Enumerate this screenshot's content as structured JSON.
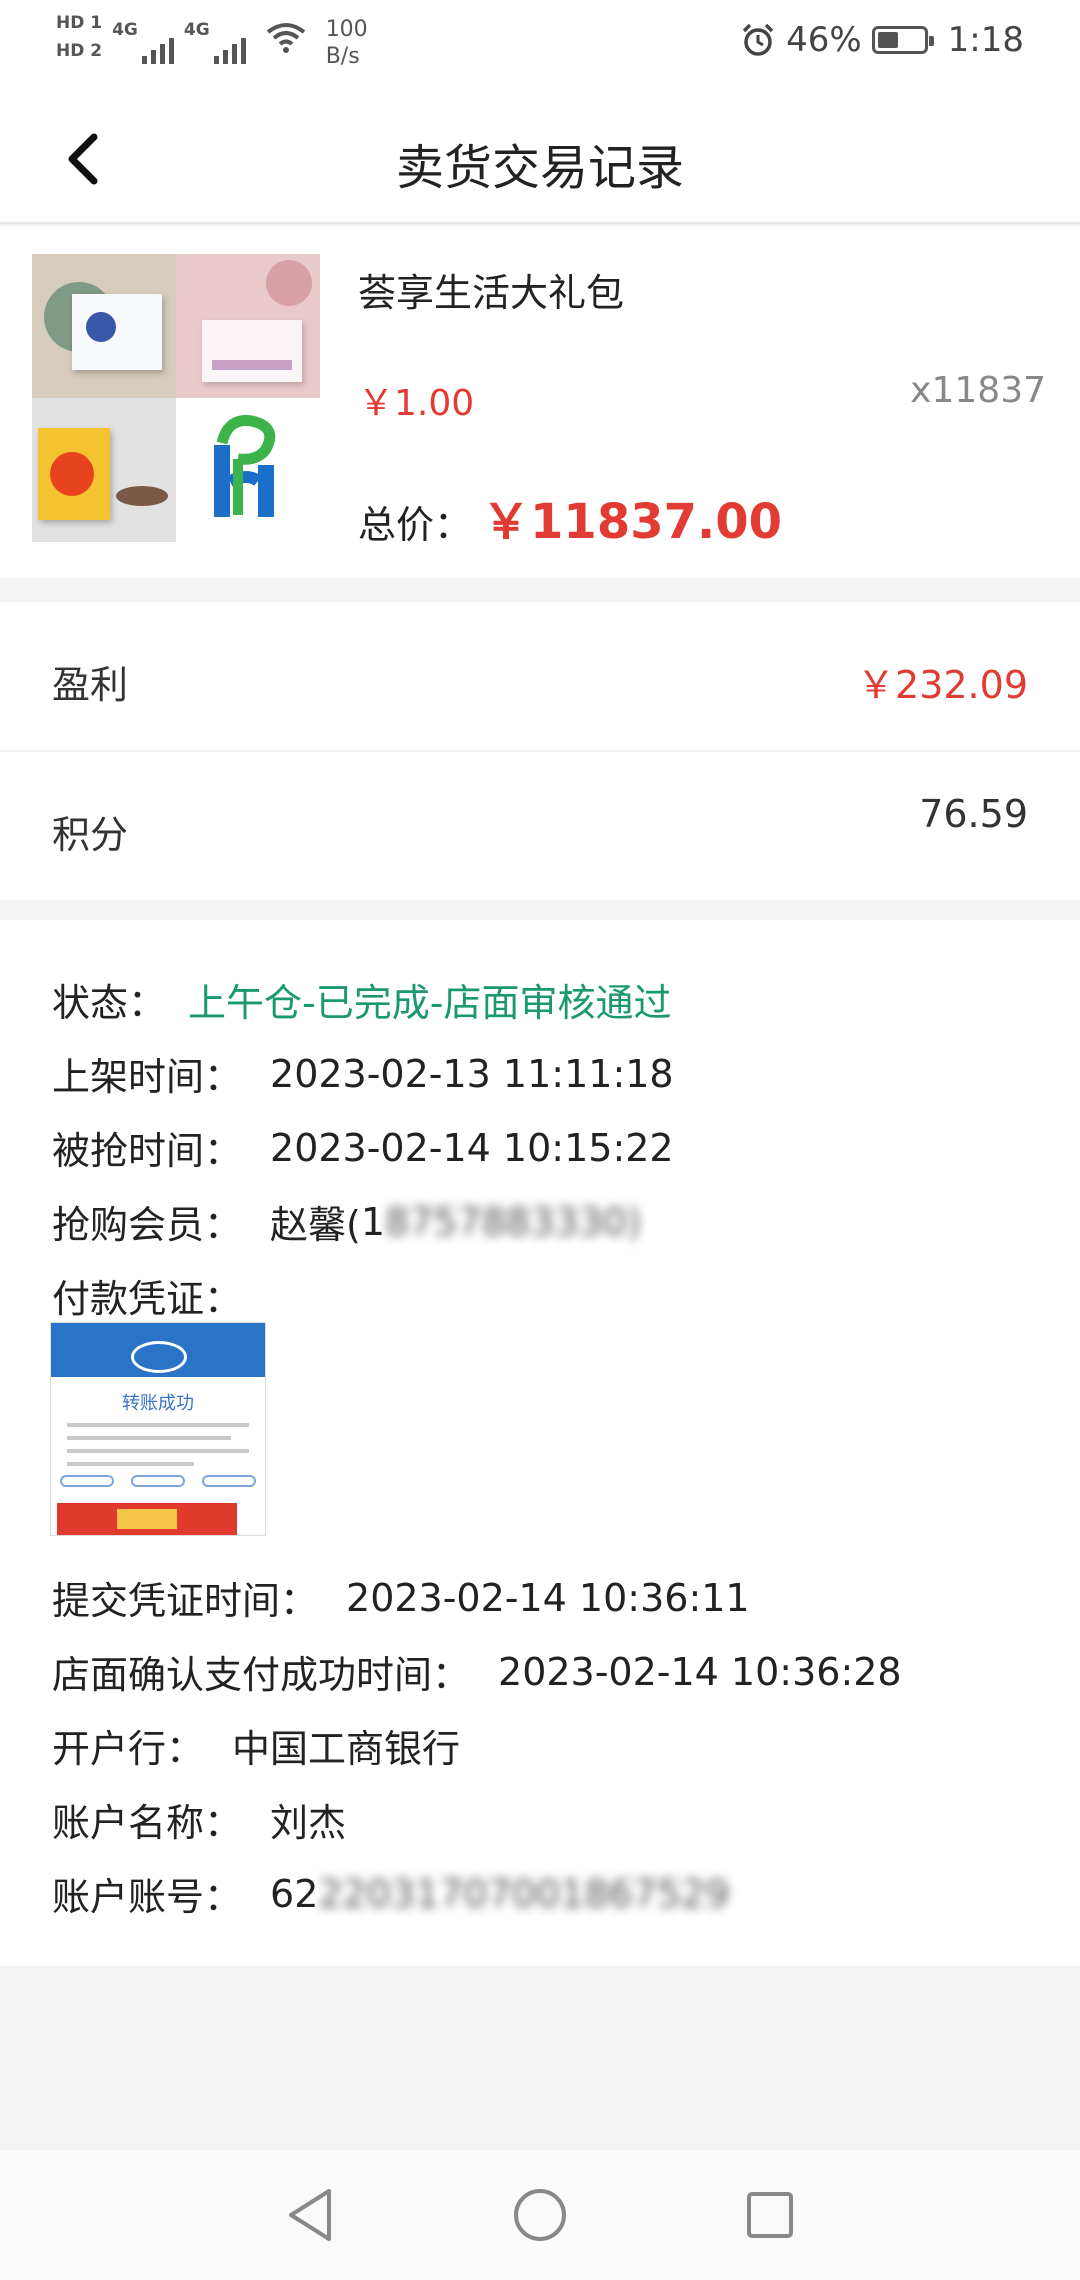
{
  "status_bar": {
    "sim1": "HD 1",
    "sim2": "HD 2",
    "net1": "4G",
    "net2": "4G",
    "speed_value": "100",
    "speed_unit": "B/s",
    "battery": "46%",
    "battery_level": 0.46,
    "time": "1:18"
  },
  "header": {
    "title": "卖货交易记录",
    "back_icon": "chevron-left-icon"
  },
  "product": {
    "name": "荟享生活大礼包",
    "unit_price": "￥1.00",
    "quantity": "x11837",
    "total_label": "总价：",
    "total_value": "￥11837.00"
  },
  "stats": {
    "profit_label": "盈利",
    "profit_value": "￥232.09",
    "points_label": "积分",
    "points_value": "76.59"
  },
  "details": {
    "status_label": "状态：",
    "status_value": "上午仓-已完成-店面审核通过",
    "listed_label": "上架时间：",
    "listed_value": "2023-02-13 11:11:18",
    "grabbed_label": "被抢时间：",
    "grabbed_value": "2023-02-14 10:15:22",
    "member_label": "抢购会员：",
    "member_name": "赵馨(",
    "member_phone_visible": "1",
    "member_phone_blurred": "8757883330)",
    "voucher_label": "付款凭证：",
    "voucher_success_text": "转账成功",
    "submit_time_label": "提交凭证时间：",
    "submit_time_value": "2023-02-14 10:36:11",
    "confirm_time_label": "店面确认支付成功时间：",
    "confirm_time_value": "2023-02-14 10:36:28",
    "bank_label": "开户行：",
    "bank_value": "中国工商银行",
    "account_name_label": "账户名称：",
    "account_name_value": "刘杰",
    "account_no_label": "账户账号：",
    "account_no_visible": "62",
    "account_no_blurred": "22031707001867529"
  },
  "nav": {
    "back": "triangle-back-icon",
    "home": "circle-home-icon",
    "recent": "square-recent-icon"
  },
  "colors": {
    "accent_red": "#e13b33",
    "status_green": "#1a9a6c",
    "background": "#f3f3f3"
  }
}
